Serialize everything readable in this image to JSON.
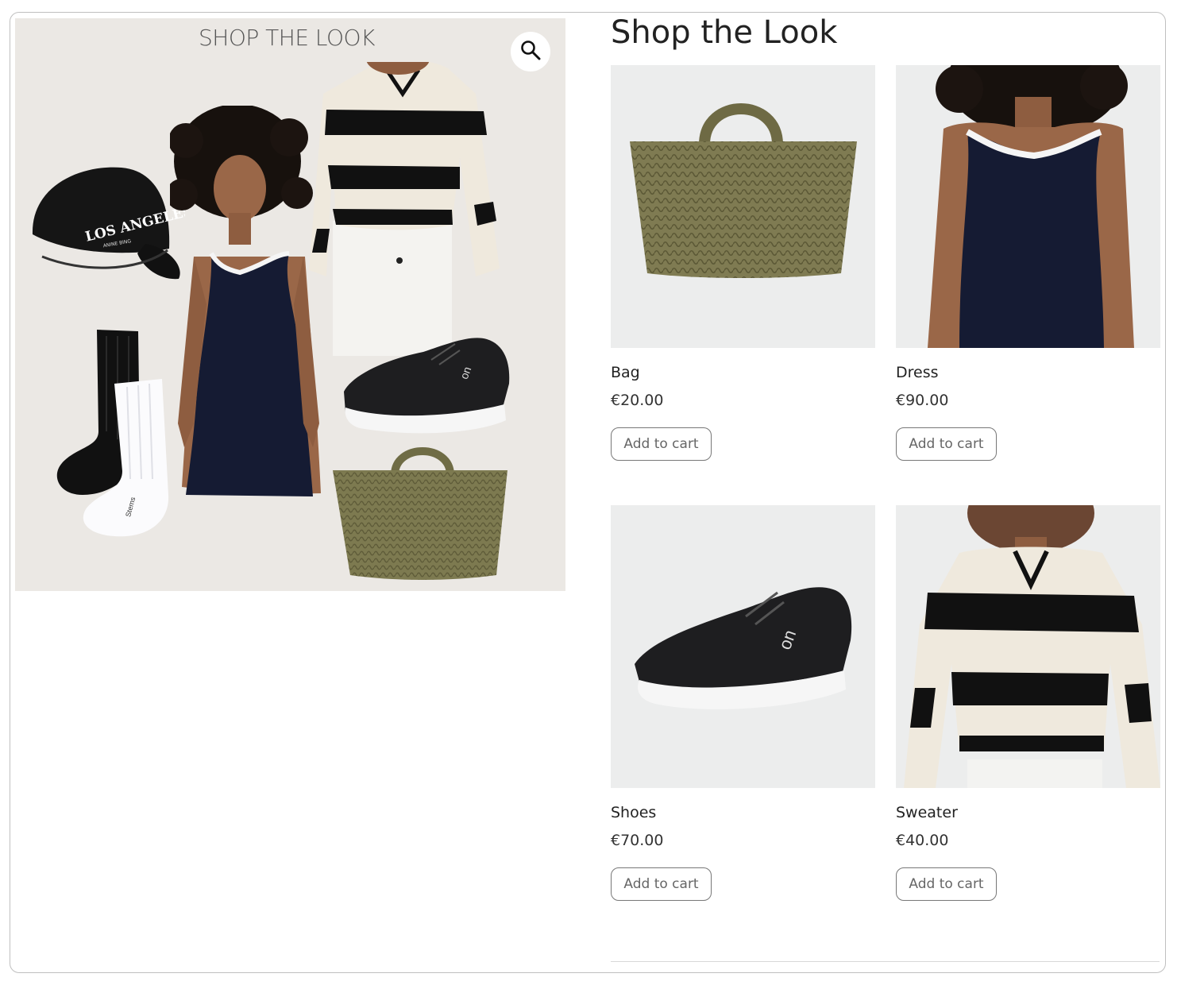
{
  "collage": {
    "title": "SHOP THE LOOK",
    "zoom_icon": "magnifier-icon",
    "cap_text": "LOS ANGELES",
    "cap_subtext": "ANINE BING",
    "sock_text": "Stems",
    "shoe_logo": "on"
  },
  "section": {
    "title": "Shop the Look"
  },
  "products": [
    {
      "name": "Bag",
      "price": "€20.00",
      "button": "Add to cart",
      "image": "woven-bag-image"
    },
    {
      "name": "Dress",
      "price": "€90.00",
      "button": "Add to cart",
      "image": "navy-dress-image"
    },
    {
      "name": "Shoes",
      "price": "€70.00",
      "button": "Add to cart",
      "image": "sneaker-image"
    },
    {
      "name": "Sweater",
      "price": "€40.00",
      "button": "Add to cart",
      "image": "striped-sweater-image"
    }
  ],
  "colors": {
    "bag": "#7d7a50",
    "dress": "#151b33",
    "sweater_cream": "#efe9dd",
    "stripe": "#111111",
    "collage_bg": "#ebe8e4"
  }
}
